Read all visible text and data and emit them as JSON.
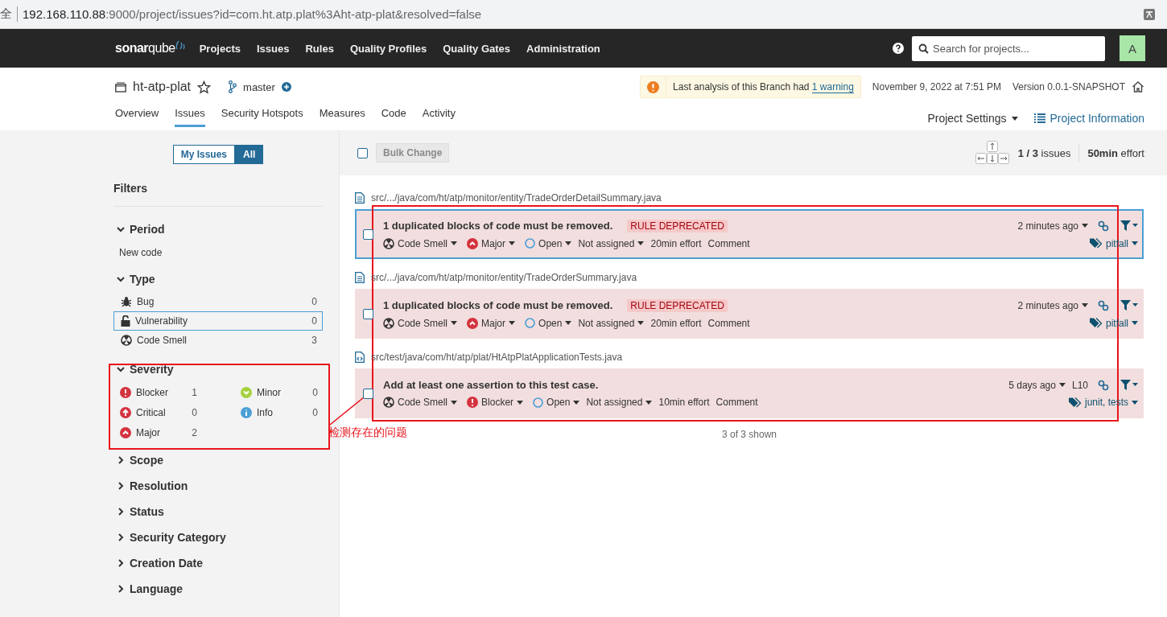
{
  "address_bar": {
    "security": "全",
    "url_host": "192.168.110.88",
    "url_rest": ":9000/project/issues?id=com.ht.atp.plat%3Aht-atp-plat&resolved=false"
  },
  "navbar": {
    "logo_bold": "sonar",
    "logo_light": "qube",
    "items": [
      "Projects",
      "Issues",
      "Rules",
      "Quality Profiles",
      "Quality Gates",
      "Administration"
    ],
    "search": {
      "placeholder": "Search for projects..."
    },
    "avatar": "A"
  },
  "project": {
    "name": "ht-atp-plat",
    "branch": "master",
    "warning_text": "Last analysis of this Branch had ",
    "warning_link": "1 warning",
    "date": "November 9, 2022 at 7:51 PM",
    "version": "Version 0.0.1-SNAPSHOT",
    "tabs": [
      {
        "label": "Overview",
        "selected": false
      },
      {
        "label": "Issues",
        "selected": true
      },
      {
        "label": "Security Hotspots",
        "selected": false
      },
      {
        "label": "Measures",
        "selected": false
      },
      {
        "label": "Code",
        "selected": false
      },
      {
        "label": "Activity",
        "selected": false
      }
    ],
    "settings": "Project Settings",
    "information": "Project Information"
  },
  "sidebar": {
    "toggle": [
      {
        "label": "My Issues",
        "selected": false
      },
      {
        "label": "All",
        "selected": true
      }
    ],
    "title": "Filters",
    "facets": [
      {
        "kind": "text",
        "label": "Period",
        "expanded": true,
        "value": "New code"
      },
      {
        "kind": "list",
        "label": "Type",
        "expanded": true,
        "items": [
          {
            "kind": "bug",
            "label": "Bug",
            "count": "0",
            "selected": false
          },
          {
            "kind": "vulnerability",
            "label": "Vulnerability",
            "count": "0",
            "selected": true
          },
          {
            "kind": "code_smell",
            "label": "Code Smell",
            "count": "3",
            "selected": false
          }
        ]
      },
      {
        "kind": "grid",
        "label": "Severity",
        "expanded": true,
        "items": [
          {
            "kind": "blocker",
            "label": "Blocker",
            "count": "1"
          },
          {
            "kind": "minor",
            "label": "Minor",
            "count": "0"
          },
          {
            "kind": "critical",
            "label": "Critical",
            "count": "0"
          },
          {
            "kind": "info",
            "label": "Info",
            "count": "0"
          },
          {
            "kind": "major",
            "label": "Major",
            "count": "2"
          }
        ]
      },
      {
        "label": "Scope",
        "expanded": false
      },
      {
        "label": "Resolution",
        "expanded": false
      },
      {
        "label": "Status",
        "expanded": false
      },
      {
        "label": "Security Category",
        "expanded": false
      },
      {
        "label": "Creation Date",
        "expanded": false
      },
      {
        "label": "Language",
        "expanded": false
      }
    ]
  },
  "toolbar": {
    "select_all": {
      "checked": false
    },
    "bulk_change": "Bulk Change",
    "position": "1 / 3",
    "issues_label": " issues",
    "effort_value": "50min",
    "effort_label": " effort"
  },
  "issues": [
    {
      "file": {
        "kind": "source",
        "path": "src/.../java/com/ht/atp/monitor/entity/TradeOrderDetailSummary.java"
      },
      "selected": true,
      "checked": false,
      "message": "1 duplicated blocks of code must be removed.",
      "tag": "RULE DEPRECATED",
      "type": "Code Smell",
      "severity": {
        "kind": "major",
        "label": "Major"
      },
      "status": "Open",
      "assignee": "Not assigned",
      "effort": "20min effort",
      "comment": "Comment",
      "age": "2 minutes ago",
      "tags": "pitfall"
    },
    {
      "file": {
        "kind": "source",
        "path": "src/.../java/com/ht/atp/monitor/entity/TradeOrderSummary.java"
      },
      "selected": false,
      "checked": false,
      "message": "1 duplicated blocks of code must be removed.",
      "tag": "RULE DEPRECATED",
      "type": "Code Smell",
      "severity": {
        "kind": "major",
        "label": "Major"
      },
      "status": "Open",
      "assignee": "Not assigned",
      "effort": "20min effort",
      "comment": "Comment",
      "age": "2 minutes ago",
      "tags": "pitfall"
    },
    {
      "file": {
        "kind": "test",
        "path": "src/test/java/com/ht/atp/plat/HtAtpPlatApplicationTests.java"
      },
      "selected": false,
      "checked": false,
      "message": "Add at least one assertion to this test case.",
      "type": "Code Smell",
      "severity": {
        "kind": "blocker",
        "label": "Blocker"
      },
      "status": "Open",
      "assignee": "Not assigned",
      "effort": "10min effort",
      "comment": "Comment",
      "age": "5 days ago",
      "line": "L10",
      "tags": "junit, tests"
    }
  ],
  "shown": "3 of 3 shown",
  "annotation": {
    "note": "检测存在的问题"
  }
}
